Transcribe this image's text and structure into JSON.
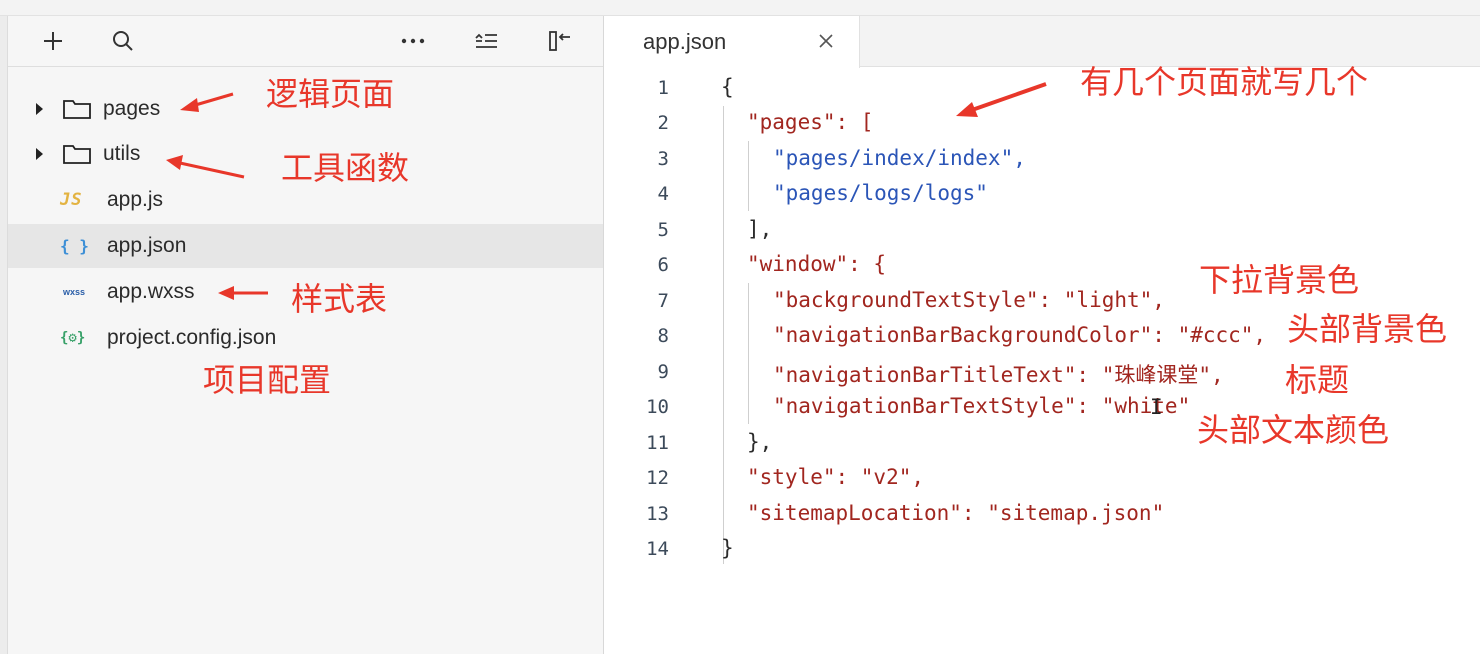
{
  "explorer": {
    "tree": [
      {
        "label": "pages",
        "type": "folder",
        "icon": "folder-icon"
      },
      {
        "label": "utils",
        "type": "folder",
        "icon": "folder-icon"
      },
      {
        "label": "app.js",
        "type": "file",
        "icon": "js-file-icon",
        "icon_text": "JS"
      },
      {
        "label": "app.json",
        "type": "file",
        "icon": "json-file-icon",
        "icon_text": "{ }",
        "selected": true
      },
      {
        "label": "app.wxss",
        "type": "file",
        "icon": "wxss-file-icon",
        "icon_text": "wxss"
      },
      {
        "label": "project.config.json",
        "type": "file",
        "icon": "config-file-icon",
        "icon_text": "{⚙}"
      }
    ],
    "toolbar": [
      "add-icon",
      "search-icon",
      "more-icon",
      "collapse-all-icon",
      "split-view-icon"
    ]
  },
  "editor": {
    "tab": {
      "label": "app.json"
    },
    "lines": [
      {
        "n": "1",
        "t": "{"
      },
      {
        "n": "2",
        "t": "\"pages\": ["
      },
      {
        "n": "3",
        "t": "\"pages/index/index\","
      },
      {
        "n": "4",
        "t": "\"pages/logs/logs\""
      },
      {
        "n": "5",
        "t": "],"
      },
      {
        "n": "6",
        "t": "\"window\": {"
      },
      {
        "n": "7",
        "t": "\"backgroundTextStyle\": \"light\","
      },
      {
        "n": "8",
        "t": "\"navigationBarBackgroundColor\": \"#ccc\","
      },
      {
        "n": "9",
        "t": "\"navigationBarTitleText\": \"珠峰课堂\","
      },
      {
        "n": "10",
        "t": "\"navigationBarTextStyle\": \"white\""
      },
      {
        "n": "11",
        "t": "},"
      },
      {
        "n": "12",
        "t": "\"style\": \"v2\","
      },
      {
        "n": "13",
        "t": "\"sitemapLocation\": \"sitemap.json\""
      },
      {
        "n": "14",
        "t": "}"
      }
    ]
  },
  "annotations": {
    "pages": "逻辑页面",
    "utils": "工具函数",
    "wxss": "样式表",
    "config": "项目配置",
    "pages_count": "有几个页面就写几个",
    "bg_text": "下拉背景色",
    "nav_bg": "头部背景色",
    "title": "标题",
    "nav_text": "头部文本颜色"
  },
  "colors": {
    "annotation": "#e8372a",
    "json_key": "#a1261f",
    "json_string": "#2b55b7",
    "selected_row": "#e6e6e6"
  }
}
